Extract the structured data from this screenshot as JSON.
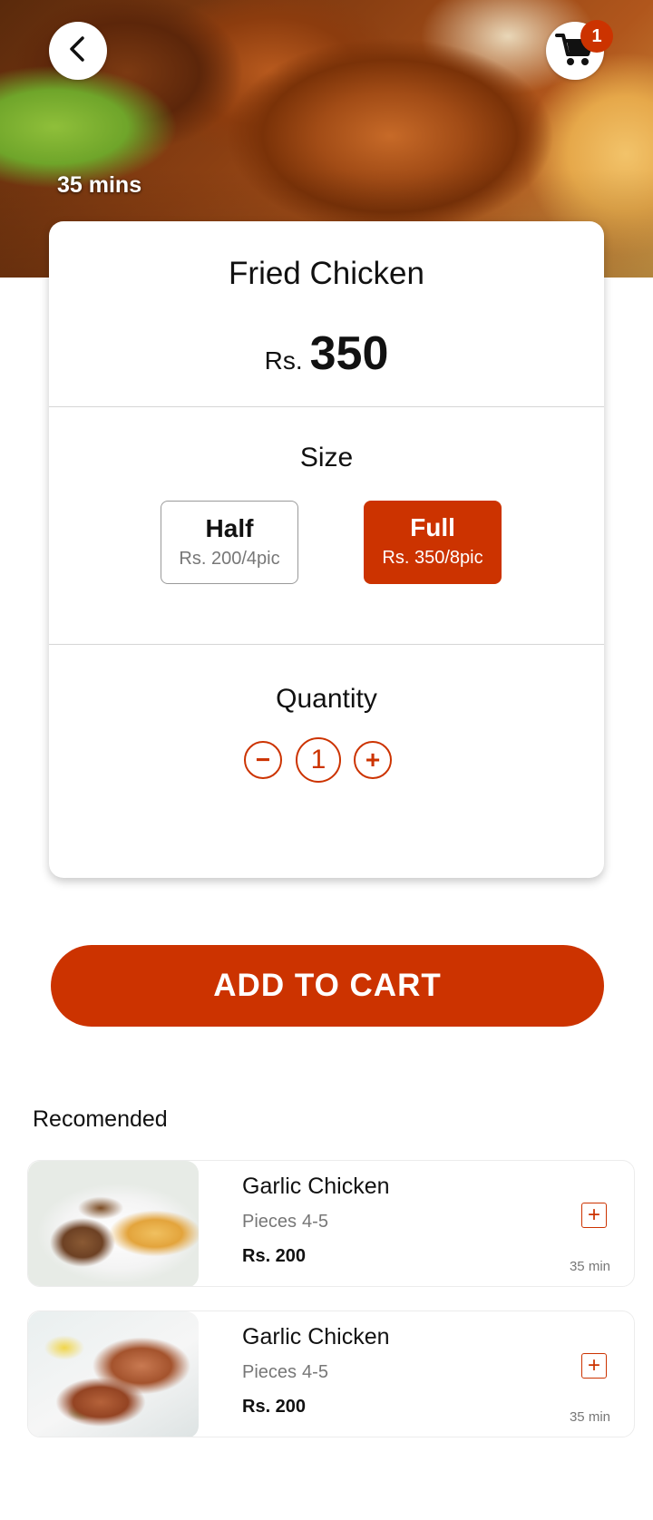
{
  "header": {
    "back_icon": "chevron-left-icon",
    "cart_icon": "shopping-cart-icon",
    "cart_count": "1",
    "delivery_time": "35 mins"
  },
  "product": {
    "name": "Fried Chicken",
    "currency": "Rs.",
    "price": "350"
  },
  "size": {
    "title": "Size",
    "options": [
      {
        "name": "Half",
        "detail": "Rs. 200/4pic",
        "selected": false
      },
      {
        "name": "Full",
        "detail": "Rs. 350/8pic",
        "selected": true
      }
    ]
  },
  "quantity": {
    "title": "Quantity",
    "minus": "−",
    "value": "1",
    "plus": "+"
  },
  "add_to_cart": "ADD TO CART",
  "recommended": {
    "heading": "Recomended",
    "items": [
      {
        "name": "Garlic Chicken",
        "pieces_label": "Pieces",
        "pieces": "4-5",
        "price": "Rs. 200",
        "add": "+",
        "time": "35 min"
      },
      {
        "name": "Garlic Chicken",
        "pieces_label": "Pieces",
        "pieces": "4-5",
        "price": "Rs. 200",
        "add": "+",
        "time": "35 min"
      }
    ]
  },
  "colors": {
    "accent": "#cc3300",
    "muted_text": "#777777"
  }
}
